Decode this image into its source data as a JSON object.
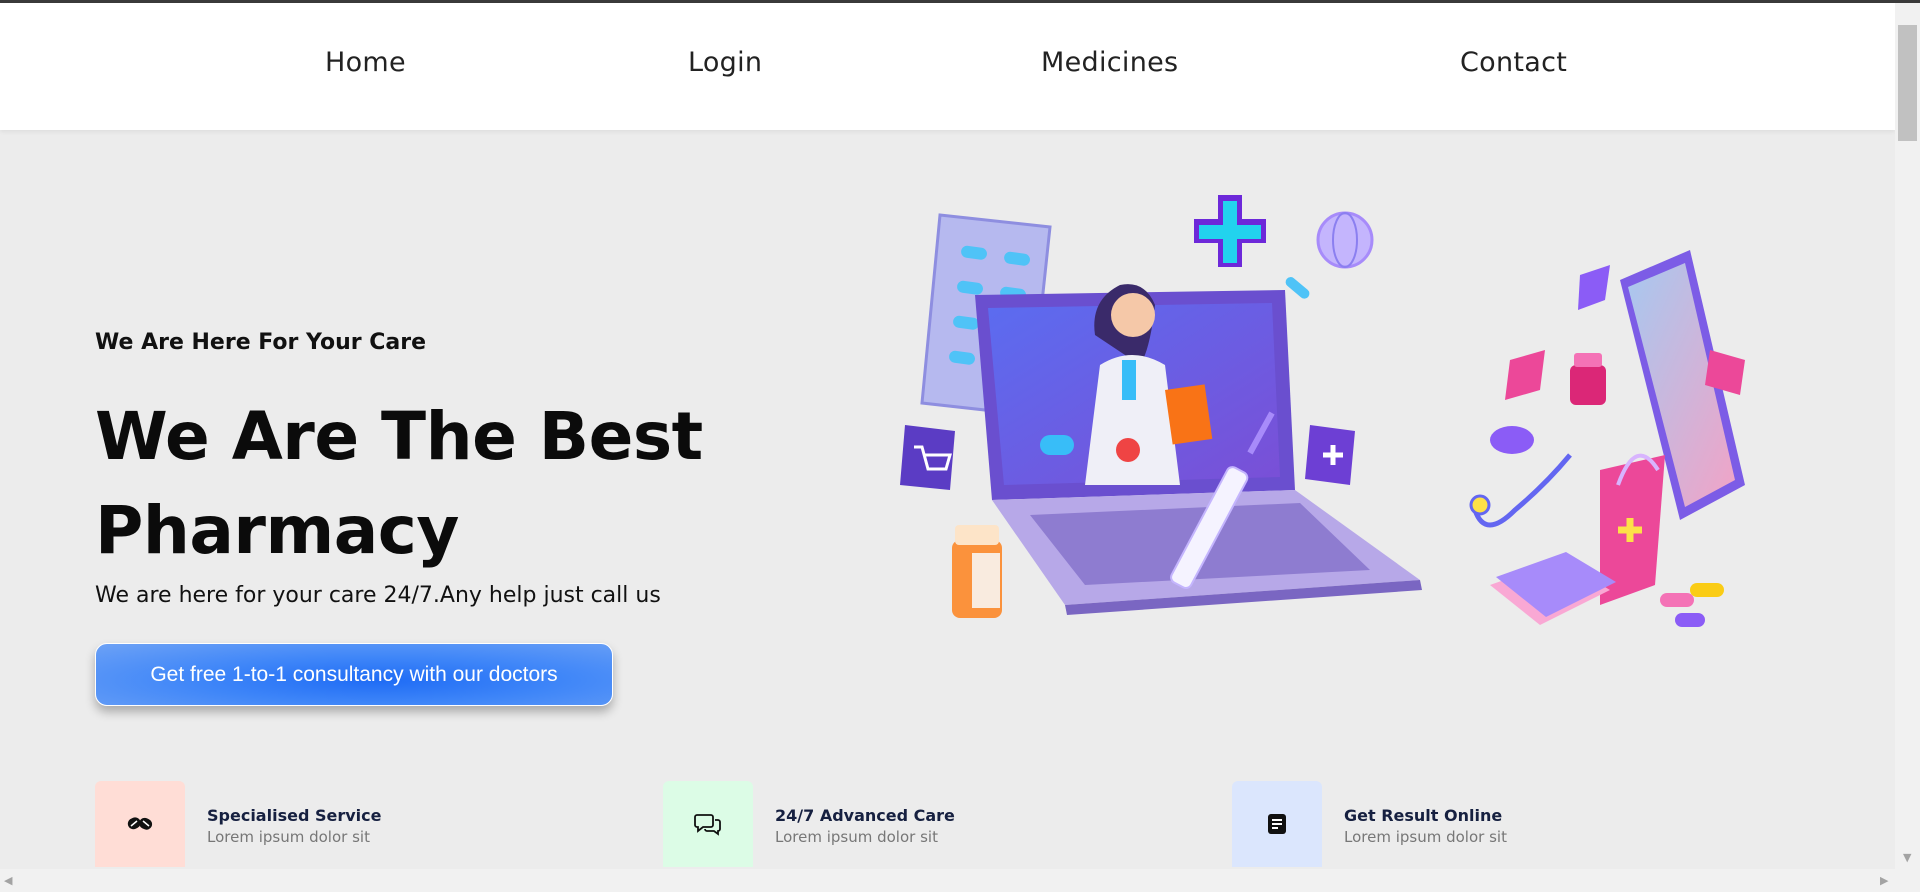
{
  "nav": {
    "items": [
      {
        "label": "Home"
      },
      {
        "label": "Login"
      },
      {
        "label": "Medicines"
      },
      {
        "label": "Contact"
      }
    ]
  },
  "hero": {
    "tagline": "We Are Here For Your Care",
    "title_line1": "We Are The Best",
    "title_line2": "Pharmacy",
    "subtitle": "We are here for your care 24/7.Any help just call us",
    "cta_label": "Get free 1-to-1 consultancy with our doctors",
    "illustration_icon": "doctor-laptop-pharmacy-illustration"
  },
  "features": [
    {
      "title": "Specialised Service",
      "desc": "Lorem ipsum dolor sit",
      "icon": "pills-icon",
      "bg": "#ffddd6"
    },
    {
      "title": "24/7 Advanced Care",
      "desc": "Lorem ipsum dolor sit",
      "icon": "chat-bubbles-icon",
      "bg": "#dcfce6"
    },
    {
      "title": "Get Result Online",
      "desc": "Lorem ipsum dolor sit",
      "icon": "document-icon",
      "bg": "#dbe6fd"
    }
  ],
  "colors": {
    "accent": "#1f6cf5",
    "page_bg": "#ececec",
    "heading": "#0b0b0b",
    "feature_title": "#162040"
  }
}
